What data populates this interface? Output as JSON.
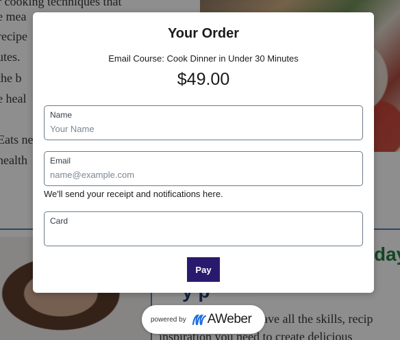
{
  "background": {
    "text_lines": [
      "r cooking techniques that",
      "e mea",
      "recipe",
      "utes.",
      "the b",
      "e heal",
      "Eats ne",
      "health"
    ],
    "day_fragment": "day",
    "heading_fragment": "y p",
    "bottom_line_1": "have all the skills, recip",
    "bottom_line_2": "inspiration you need to create delicious"
  },
  "modal": {
    "title": "Your Order",
    "course_name": "Email Course: Cook Dinner in Under 30 Minutes",
    "price": "$49.00",
    "name_field": {
      "label": "Name",
      "value": "",
      "placeholder": "Your Name"
    },
    "email_field": {
      "label": "Email",
      "value": "",
      "placeholder": "name@example.com"
    },
    "email_hint": "We'll send your receipt and notifications here.",
    "card_field": {
      "label": "Card",
      "value": ""
    },
    "pay_label": "Pay"
  },
  "badge": {
    "prefix": "powered by",
    "brand": "AWeber",
    "logo_icon": "aweber-wave-icon"
  },
  "colors": {
    "pay_button": "#2a1a6e",
    "brand_blue": "#1b6ee0",
    "field_border": "#6b7a8a"
  }
}
